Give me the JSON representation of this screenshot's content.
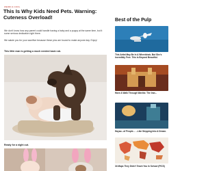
{
  "article": {
    "category": "WEIRD & COOL",
    "title": "This Is Why Kids Need Pets. Warning: Cuteness Overload!",
    "paragraphs": [
      "We don't know how any parent could handle having a baby and a puppy at the same time, but it some serious dedication right there.",
      "We salute you for your sacrifice because these pics are bound to make anyone day. Enjoy!"
    ],
    "captions": [
      "This little man is getting a much needed back rub.",
      "Ready for a night out."
    ]
  },
  "sidebar": {
    "heading": "Best of the Pulp",
    "items": [
      {
        "label": "This Artist May Be In A Wheelchair, But She's Incredibly Free. This Is Beyond Beautiful."
      },
      {
        "label": "Have A Walk Through Worlds: The Iran..."
      },
      {
        "label": "Hayao...of People... ...Like Stepping Into A Dream."
      },
      {
        "label": "34 Maps They Didn't Teach You In School (PICS)"
      }
    ]
  },
  "colors": {
    "accent": "#c0392b",
    "background": "#ffffff"
  }
}
